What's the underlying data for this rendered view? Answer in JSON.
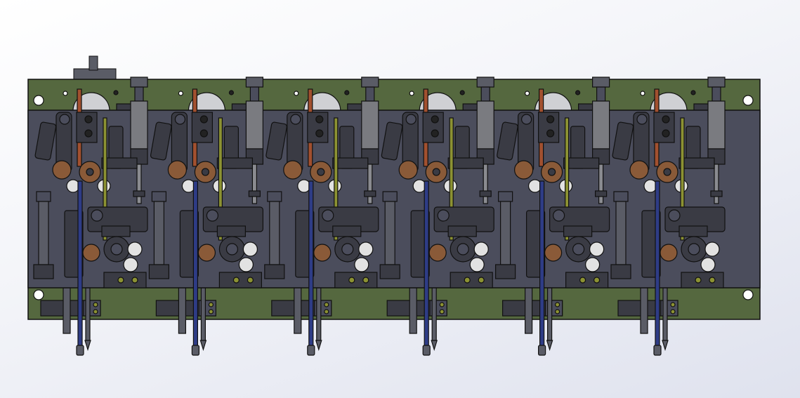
{
  "viewport": {
    "model_units": 6,
    "colors": {
      "plate_green": "#55683f",
      "panel_gray": "#4b4d5c",
      "part_dark": "#3a3b44",
      "red_rod": "#a2502f",
      "olive_rod": "#8c9233",
      "blue_rod": "#2e3c86",
      "bushing_brown": "#8a5a38",
      "screw_white": "#e2e2e2",
      "outline": "#111111"
    }
  }
}
